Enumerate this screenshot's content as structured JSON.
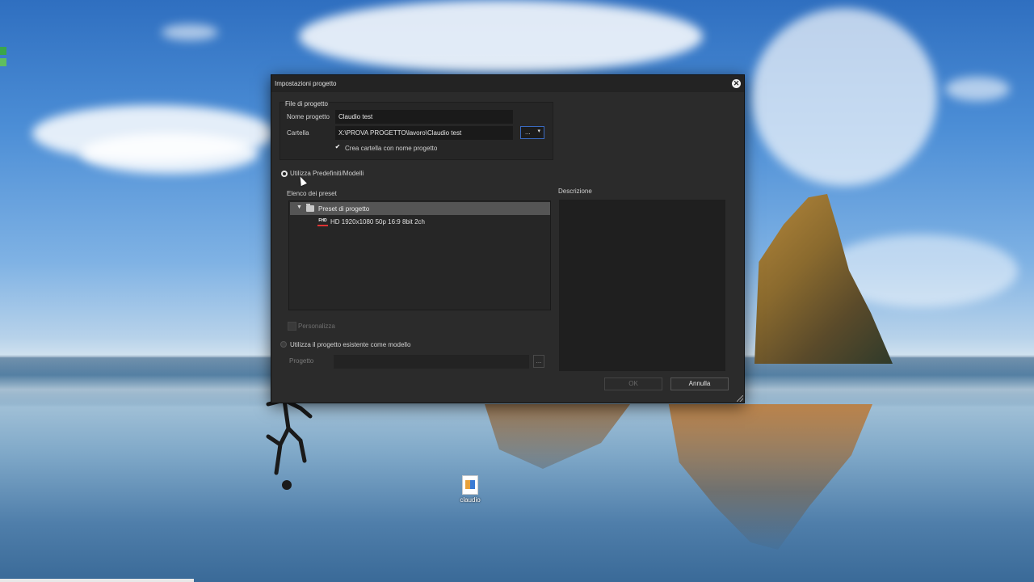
{
  "desktop": {
    "file_icon": {
      "label": "claudio",
      "icon": "document-file-icon"
    }
  },
  "dialog": {
    "title": "Impostazioni progetto",
    "close_icon": "close-icon",
    "file_group": {
      "label": "File di progetto",
      "name_label": "Nome progetto",
      "name_value": "Claudio test",
      "folder_label": "Cartella",
      "folder_value": "X:\\PROVA PROGETTO\\lavoro\\Claudio test",
      "browse_label": "...",
      "browse_arrow": "▾",
      "create_folder_label": "Crea cartella con nome progetto",
      "create_folder_checked": true
    },
    "use_presets": {
      "label": "Utilizza Predefiniti/Modelli",
      "selected": true,
      "list_label": "Elenco dei preset",
      "folder": {
        "label": "Preset di progetto",
        "expanded": true
      },
      "items": [
        {
          "badge": "FHD",
          "label": "HD 1920x1080 50p 16:9 8bit 2ch"
        }
      ],
      "customize_label": "Personalizza"
    },
    "description_label": "Descrizione",
    "use_existing": {
      "label": "Utilizza il progetto esistente come modello",
      "selected": false,
      "project_label": "Progetto",
      "project_value": "",
      "browse_label": "..."
    },
    "buttons": {
      "ok": "OK",
      "cancel": "Annulla"
    }
  }
}
